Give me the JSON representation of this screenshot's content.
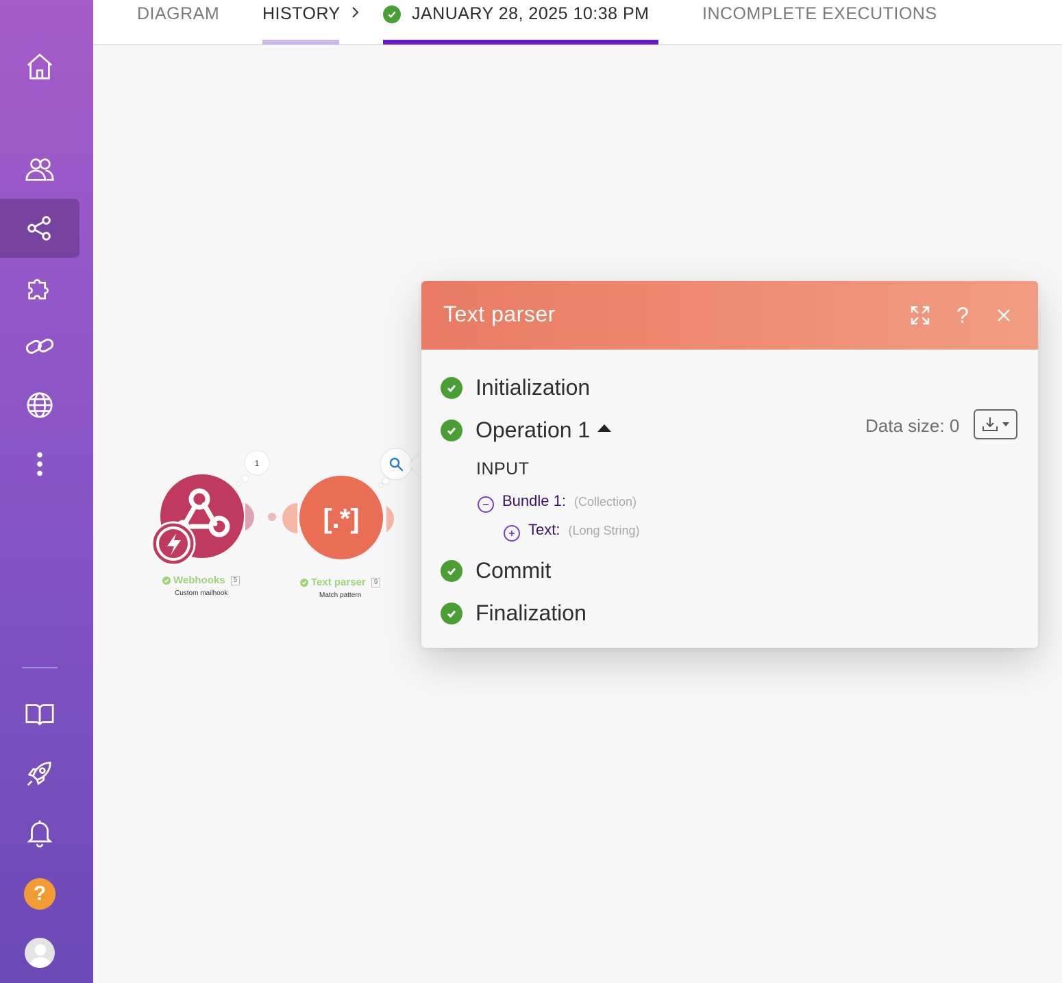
{
  "tabs": {
    "diagram": "DIAGRAM",
    "history": "HISTORY",
    "execution": "JANUARY 28, 2025 10:38 PM",
    "incomplete": "INCOMPLETE EXECUTIONS"
  },
  "sidebar": {
    "items": [
      "home-icon",
      "team-icon",
      "scenarios-icon",
      "apps-icon",
      "connections-icon",
      "webhooks-icon",
      "more-icon",
      "docs-icon",
      "whats-new-icon",
      "notifications-icon",
      "help-icon",
      "avatar"
    ],
    "active": "scenarios-icon",
    "help_label": "?"
  },
  "modules": [
    {
      "name": "Webhooks",
      "id": "5",
      "subtitle": "Custom mailhook",
      "color": "#c0395f",
      "bubble_count": "1"
    },
    {
      "name": "Text parser",
      "id": "9",
      "subtitle": "Match pattern",
      "color": "#ea6e55"
    }
  ],
  "text_parser_symbol": "[.*]",
  "panel": {
    "title": "Text parser",
    "steps": {
      "initialization": "Initialization",
      "operation": "Operation 1",
      "commit": "Commit",
      "finalization": "Finalization"
    },
    "data_size_label": "Data size: 0",
    "section_label": "INPUT",
    "bundle": {
      "key": "Bundle 1:",
      "type": "(Collection)"
    },
    "text_field": {
      "key": "Text:",
      "type": "(Long String)"
    }
  },
  "colors": {
    "accent_purple": "#6d17c9",
    "history_underline": "#cdb6ea",
    "success_green": "#4a9f34",
    "panel_header": "#ec8068"
  }
}
